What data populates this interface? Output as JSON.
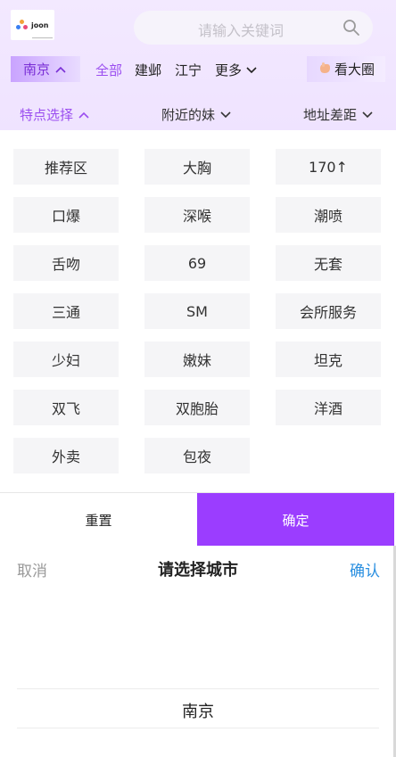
{
  "header": {
    "logo_text": "joon",
    "search_placeholder": "请输入关键词",
    "icons": {
      "search": "search-icon"
    }
  },
  "city_bar": {
    "current_city": "南京",
    "districts": [
      "全部",
      "建邺",
      "江宁"
    ],
    "active_district": "全部",
    "more_label": "更多",
    "circle_button_label": "看大圈"
  },
  "filters": {
    "feature_label": "特点选择",
    "nearby_label": "附近的妹",
    "distance_label": "地址差距"
  },
  "tags": [
    "推荐区",
    "大胸",
    "170↑",
    "口爆",
    "深喉",
    "潮喷",
    "舌吻",
    "69",
    "无套",
    "三通",
    "SM",
    "会所服务",
    "少妇",
    "嫩妹",
    "坦克",
    "双飞",
    "双胞胎",
    "洋酒",
    "外卖",
    "包夜"
  ],
  "actions": {
    "reset": "重置",
    "confirm": "确定"
  },
  "picker": {
    "cancel": "取消",
    "title": "请选择城市",
    "confirm": "确认",
    "selected_option": "南京"
  },
  "colors": {
    "accent": "#9b3dff",
    "accent_text": "#9b4ef0",
    "link_blue": "#2a8fe0",
    "header_bg": "#f3e9ff"
  }
}
